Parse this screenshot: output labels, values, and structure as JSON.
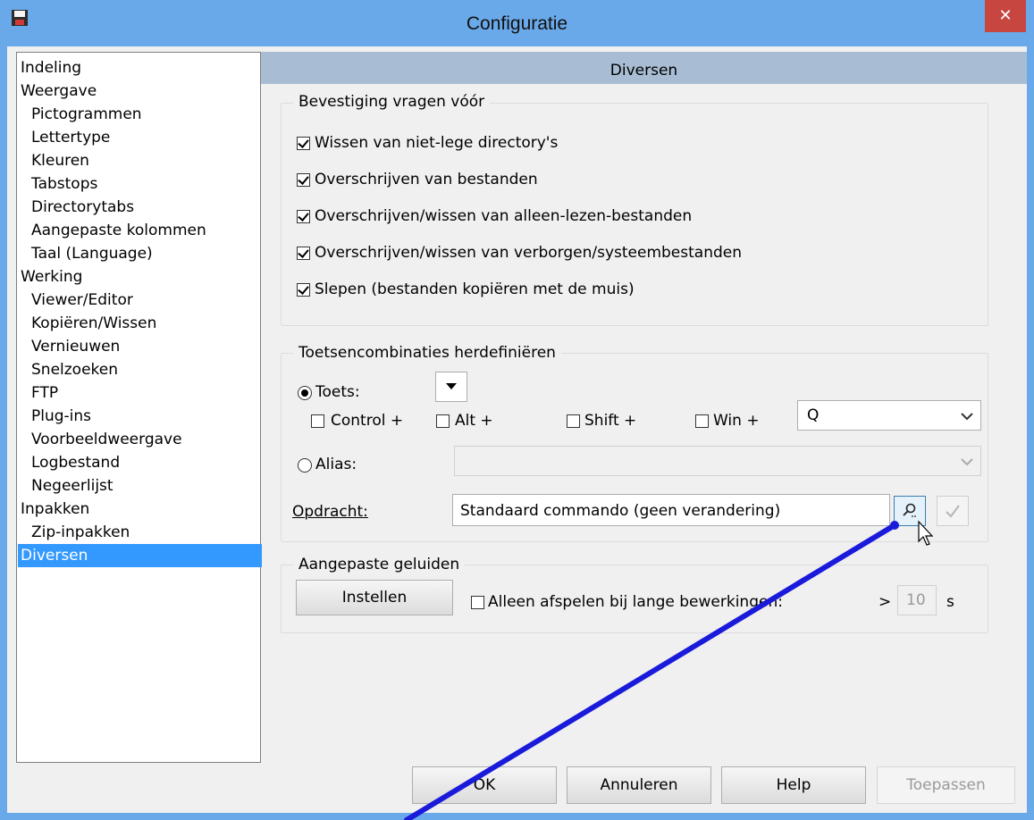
{
  "window": {
    "title": "Configuratie",
    "close_glyph": "✕"
  },
  "tree": {
    "items": [
      {
        "label": "Indeling",
        "level": 0
      },
      {
        "label": "Weergave",
        "level": 0
      },
      {
        "label": "Pictogrammen",
        "level": 1
      },
      {
        "label": "Lettertype",
        "level": 1
      },
      {
        "label": "Kleuren",
        "level": 1
      },
      {
        "label": "Tabstops",
        "level": 1
      },
      {
        "label": "Directorytabs",
        "level": 1
      },
      {
        "label": "Aangepaste kolommen",
        "level": 1
      },
      {
        "label": "Taal (Language)",
        "level": 1
      },
      {
        "label": "Werking",
        "level": 0
      },
      {
        "label": "Viewer/Editor",
        "level": 1
      },
      {
        "label": "Kopiëren/Wissen",
        "level": 1
      },
      {
        "label": "Vernieuwen",
        "level": 1
      },
      {
        "label": "Snelzoeken",
        "level": 1
      },
      {
        "label": "FTP",
        "level": 1
      },
      {
        "label": "Plug-ins",
        "level": 1
      },
      {
        "label": "Voorbeeldweergave",
        "level": 1
      },
      {
        "label": "Logbestand",
        "level": 1
      },
      {
        "label": "Negeerlijst",
        "level": 1
      },
      {
        "label": "Inpakken",
        "level": 0
      },
      {
        "label": "Zip-inpakken",
        "level": 1
      },
      {
        "label": "Diversen",
        "level": 0,
        "selected": true
      }
    ]
  },
  "panel": {
    "title": "Diversen"
  },
  "confirm": {
    "label": "Bevestiging vragen vóór",
    "items": [
      {
        "label": "Wissen van niet-lege directory's",
        "checked": true
      },
      {
        "label": "Overschrijven van bestanden",
        "checked": true
      },
      {
        "label": "Overschrijven/wissen van alleen-lezen-bestanden",
        "checked": true
      },
      {
        "label": "Overschrijven/wissen van verborgen/systeembestanden",
        "checked": true
      },
      {
        "label": "Slepen (bestanden kopiëren met de muis)",
        "checked": true
      }
    ]
  },
  "hotkeys": {
    "label": "Toetsencombinaties herdefiniëren",
    "toets_label": "Toets:",
    "control_label": "Control +",
    "alt_label": "Alt +",
    "shift_label": "Shift +",
    "win_label": "Win +",
    "key_value": "Q",
    "alias_label": "Alias:",
    "alias_value": "",
    "command_label": "Opdracht:",
    "command_value": "Standaard commando (geen verandering)"
  },
  "sounds": {
    "label": "Aangepaste geluiden",
    "set_button": "Instellen",
    "long_ops_label": "Alleen afspelen bij lange bewerkingen:",
    "gt": ">",
    "seconds_value": "10",
    "seconds_unit": "s"
  },
  "buttons": {
    "ok": "OK",
    "cancel": "Annuleren",
    "help": "Help",
    "apply": "Toepassen"
  },
  "colors": {
    "titlebar": "#6aa9e9",
    "selection": "#3399ff",
    "header": "#a8bdd3",
    "annotation_line": "#1a1adb",
    "close": "#c7463f"
  },
  "icons": [
    "save-icon",
    "close-icon",
    "dropdown-arrow-icon",
    "search-icon",
    "check-icon",
    "cursor-icon"
  ]
}
